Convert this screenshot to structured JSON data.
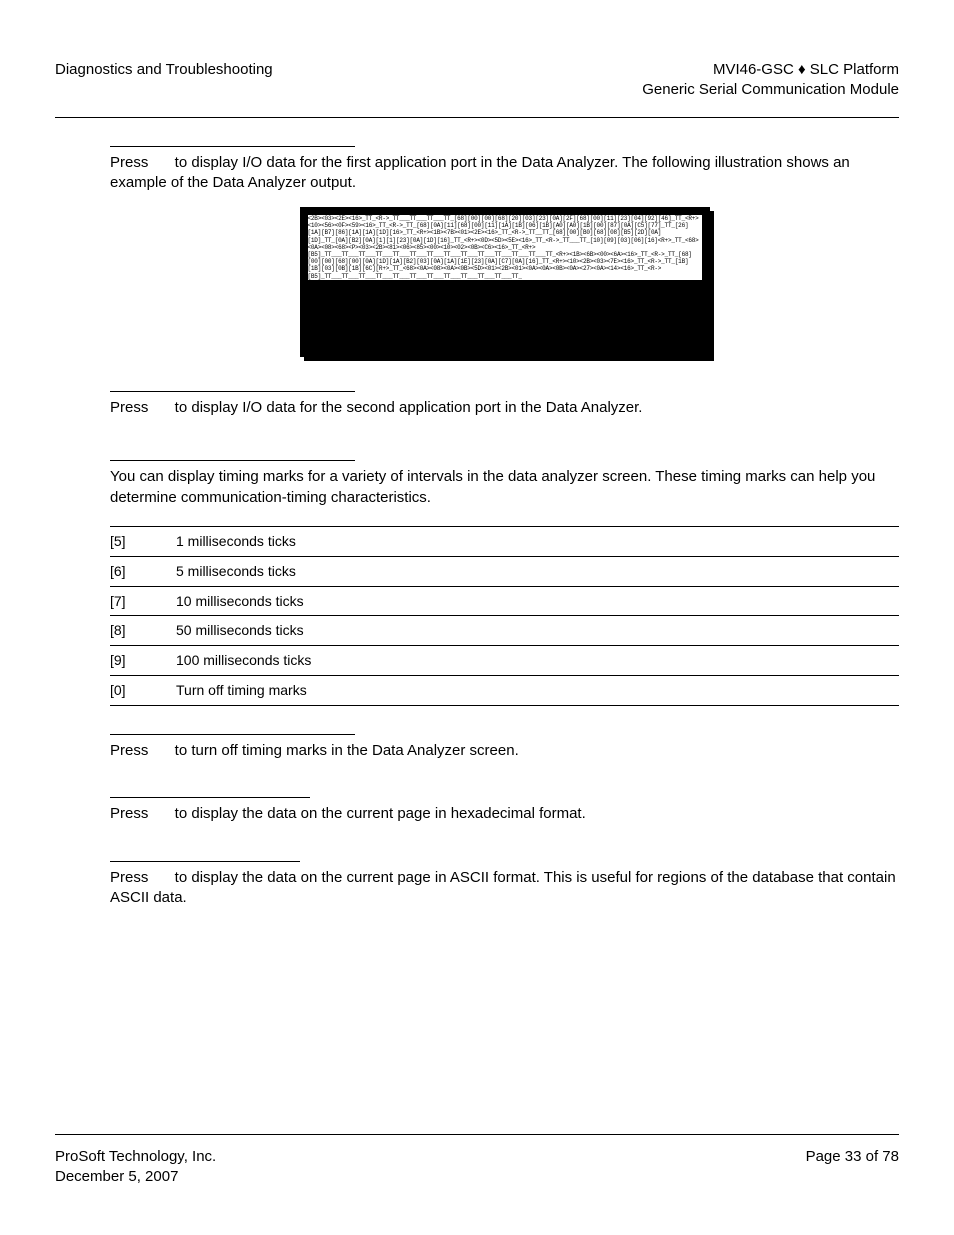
{
  "header": {
    "left": "Diagnostics and Troubleshooting",
    "rightLine1": "MVI46-GSC ♦ SLC Platform",
    "rightLine2": "Generic Serial Communication Module"
  },
  "sections": {
    "s1": {
      "pressPrefix": "Press",
      "text1": " to display I/O data for the first application port in the Data Analyzer. The following illustration shows an example of the Data Analyzer output."
    },
    "analyzerDump": "<2B><03><2E><16>_TT_<R->_TT___TT___TT___TT_[68][00][00][68][20][03][23][0A][2F][68][00][11][23][04][92][46]_TT_<R+><10><56><0F><59><16>_TT_<R->_TT_[68][0A][11][68][00][11][1A][1B][06][1B][A0][A0][1B][00][87][0A][C5][77]_TT_[26][1A][B7][86][1A][1A][1D][16>_TT_<R+><1B><7B><01><2E><16>_TT_<R->_TT__TT_[68][00][B0][68][08][B5][2D][0A][1D]_TT_[0A][B2][0A][1][1][23][0A][1D][16]_TT_<R+><0D><5D><5E><16>_TT_<R->_TT___TT_[10][09][03][06][16]<R+>_TT_<68><0A><08><68><P><03><2B><81><06><85><00><10><02><0B><C6><16>_TT_<R+>[B5]_TT___TT___TT___TT___TT___TT___TT___TT___TT___TT___TT___TT___TT___TT_<R+><1B><6B><00><6A><16>_TT_<R->_TT_[68][00][00][68][00][0A][1D][1A][B2][03][0A][1A][1E][23][0A][C7][0A][16]_TT_<R+><10><2B><03><7E><16>_TT_<R->_TT_[1B][1B][03][0B][1B][6C][R+>_TT_<68><0A><08><0A><0B><5D><01><2B><01><0A><0A><0B><0A><27><0A><14><16>_TT_<R->[B5]_TT___TT___TT___TT___TT___TT___TT___TT___TT___TT___TT___TT_",
    "s2": {
      "pressPrefix": "Press",
      "text1": " to display I/O data for the second application port in the Data Analyzer."
    },
    "s3": {
      "text": "You can display timing marks for a variety of intervals in the data analyzer screen. These timing marks can help you determine communication-timing characteristics."
    },
    "table": [
      {
        "k": "[5]",
        "v": "1 milliseconds ticks"
      },
      {
        "k": "[6]",
        "v": "5 milliseconds ticks"
      },
      {
        "k": "[7]",
        "v": "10 milliseconds ticks"
      },
      {
        "k": "[8]",
        "v": "50 milliseconds ticks"
      },
      {
        "k": "[9]",
        "v": "100 milliseconds ticks"
      },
      {
        "k": "[0]",
        "v": "Turn off timing marks"
      }
    ],
    "s4": {
      "pressPrefix": "Press",
      "text1": " to turn off timing marks in the Data Analyzer screen."
    },
    "s5": {
      "pressPrefix": "Press",
      "text1": " to display the data on the current page in hexadecimal format."
    },
    "s6": {
      "pressPrefix": "Press",
      "text1": " to display the data on the current page in ASCII format. This is useful for regions of the database that contain ASCII data."
    }
  },
  "footer": {
    "company": "ProSoft Technology, Inc.",
    "date": "December 5, 2007",
    "page": "Page 33 of 78"
  }
}
